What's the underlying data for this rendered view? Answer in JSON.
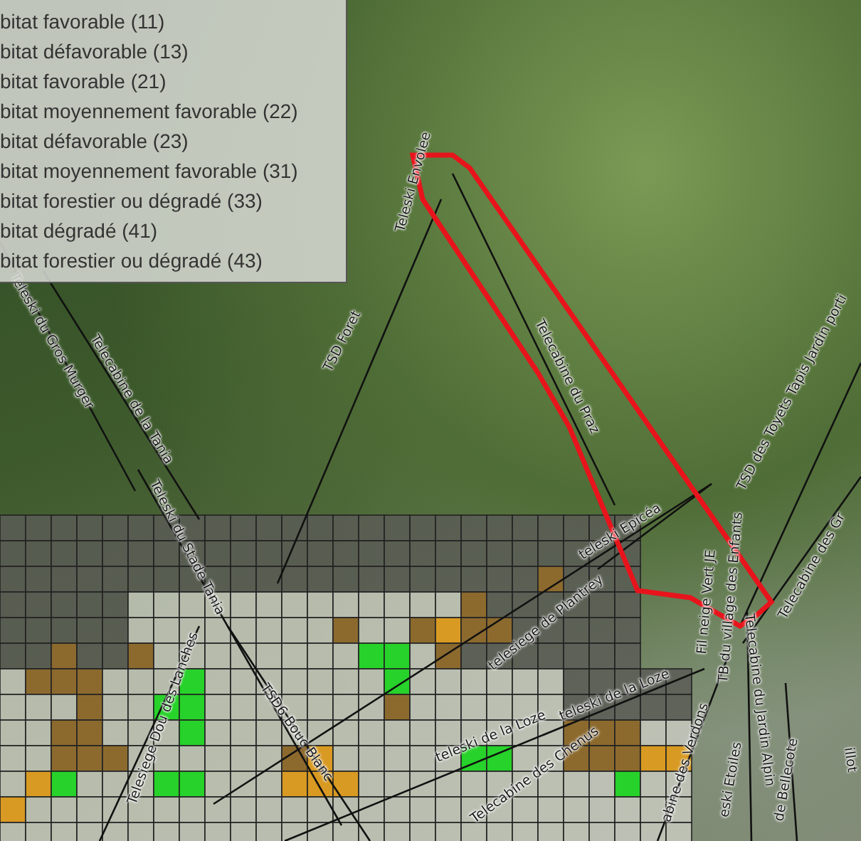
{
  "legend": {
    "items": [
      {
        "label": "bitat favorable (11)"
      },
      {
        "label": "bitat défavorable (13)"
      },
      {
        "label": "bitat favorable (21)"
      },
      {
        "label": "bitat moyennement favorable (22)"
      },
      {
        "label": "bitat défavorable (23)"
      },
      {
        "label": "bitat moyennement favorable (31)"
      },
      {
        "label": "bitat forestier ou dégradé (33)"
      },
      {
        "label": "bitat dégradé (41)"
      },
      {
        "label": "bitat forestier ou dégradé (43)"
      }
    ]
  },
  "map": {
    "lift_labels": [
      {
        "name": "Teleski Envolee"
      },
      {
        "name": "Telecabine du Praz"
      },
      {
        "name": "TSD Foret"
      },
      {
        "name": "Teleski du Gros Murger"
      },
      {
        "name": "Telecabine de la Tania"
      },
      {
        "name": "Teleski du Stade Tania"
      },
      {
        "name": "Telesiege Dou des Lanches"
      },
      {
        "name": "TSD6 Bouc Blanc"
      },
      {
        "name": "telesiege de Plantrey"
      },
      {
        "name": "teleski de la Loze"
      },
      {
        "name": "teleski de la Loze"
      },
      {
        "name": "Telecabine des Chenus"
      },
      {
        "name": "teleski Epicéa"
      },
      {
        "name": "Fil neige Vert JE"
      },
      {
        "name": "TB du village des Enfants"
      },
      {
        "name": "TSD des Toyets Tapis Jardin porti"
      },
      {
        "name": "Telecabine des Gr"
      },
      {
        "name": "Telecabine du Jardin Alpin"
      },
      {
        "name": "abine des Verdons"
      },
      {
        "name": "eski Etoiles"
      },
      {
        "name": "de Bellecote"
      },
      {
        "name": "illot"
      }
    ]
  }
}
